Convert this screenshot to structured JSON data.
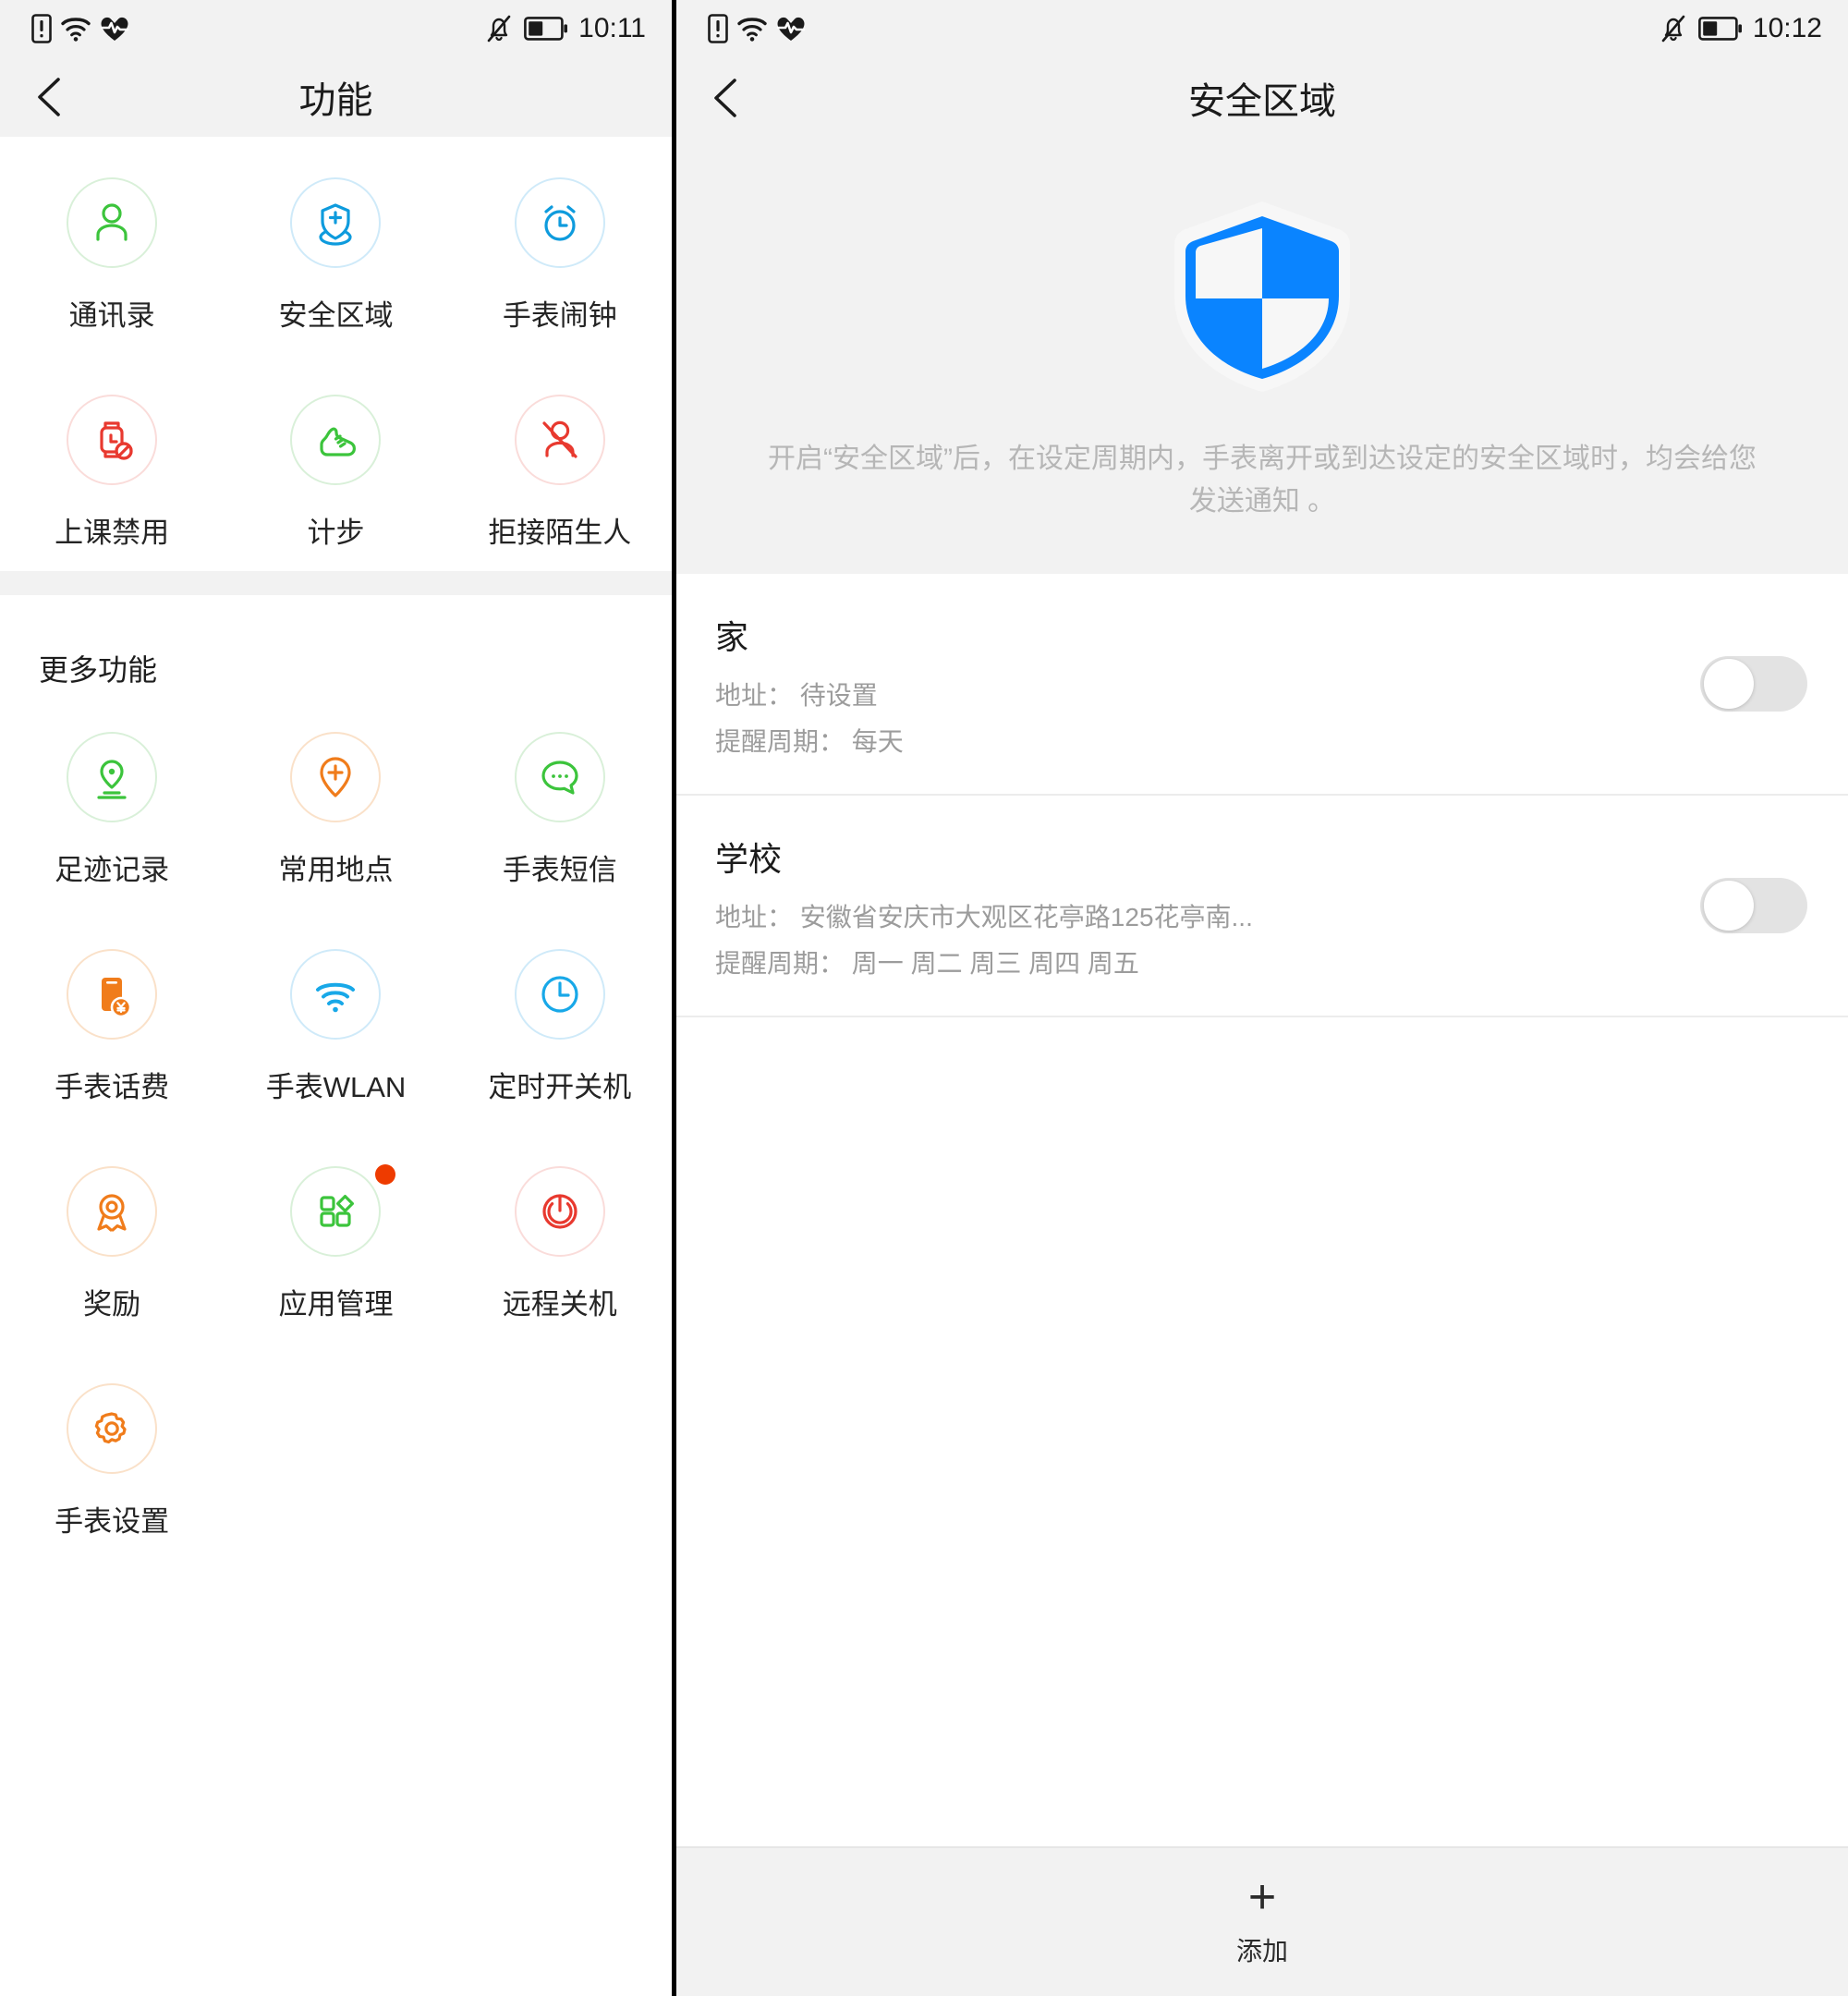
{
  "left_screen": {
    "status": {
      "time": "10:11",
      "icons": [
        "sim-alert-icon",
        "wifi-icon",
        "heart-rate-icon",
        "bell-muted-icon",
        "battery-icon"
      ]
    },
    "title": "功能",
    "back_icon": "back-arrow-icon",
    "top_features": [
      {
        "label": "通讯录",
        "icon": "contacts-icon",
        "color": "#3cc43c",
        "ring": "#d9f0d9"
      },
      {
        "label": "安全区域",
        "icon": "safe-zone-icon",
        "color": "#0e9bdd",
        "ring": "#cfeaf9"
      },
      {
        "label": "手表闹钟",
        "icon": "alarm-clock-icon",
        "color": "#0e9bdd",
        "ring": "#cfeaf9"
      },
      {
        "label": "上课禁用",
        "icon": "class-disable-icon",
        "color": "#e8392f",
        "ring": "#fadcda"
      },
      {
        "label": "计步",
        "icon": "pedometer-icon",
        "color": "#3cc43c",
        "ring": "#d9f0d9"
      },
      {
        "label": "拒接陌生人",
        "icon": "reject-stranger-icon",
        "color": "#e8392f",
        "ring": "#fadcda"
      }
    ],
    "more_section_title": "更多功能",
    "more_features": [
      {
        "label": "足迹记录",
        "icon": "footprint-track-icon",
        "color": "#3cc43c",
        "ring": "#d9f0d9",
        "badge": false
      },
      {
        "label": "常用地点",
        "icon": "favorite-place-icon",
        "color": "#f07c1b",
        "ring": "#fae1c9",
        "badge": false
      },
      {
        "label": "手表短信",
        "icon": "watch-sms-icon",
        "color": "#3cc43c",
        "ring": "#d9f0d9",
        "badge": false
      },
      {
        "label": "手表话费",
        "icon": "watch-balance-icon",
        "color": "#f07c1b",
        "ring": "#fae1c9",
        "badge": false
      },
      {
        "label": "手表WLAN",
        "icon": "wifi-icon",
        "color": "#18a8e8",
        "ring": "#cfeaf9",
        "badge": false
      },
      {
        "label": "定时开关机",
        "icon": "scheduled-power-icon",
        "color": "#18a8e8",
        "ring": "#cfeaf9",
        "badge": false
      },
      {
        "label": "奖励",
        "icon": "reward-medal-icon",
        "color": "#f07c1b",
        "ring": "#fae1c9",
        "badge": false
      },
      {
        "label": "应用管理",
        "icon": "app-manage-icon",
        "color": "#3cc43c",
        "ring": "#d9f0d9",
        "badge": true
      },
      {
        "label": "远程关机",
        "icon": "remote-power-off-icon",
        "color": "#e8392f",
        "ring": "#fadcda",
        "badge": false
      },
      {
        "label": "手表设置",
        "icon": "watch-settings-icon",
        "color": "#f07c1b",
        "ring": "#fae1c9",
        "badge": false
      }
    ]
  },
  "right_screen": {
    "status": {
      "time": "10:12",
      "icons": [
        "sim-alert-icon",
        "wifi-icon",
        "heart-rate-icon",
        "bell-muted-icon",
        "battery-icon"
      ]
    },
    "title": "安全区域",
    "back_icon": "back-arrow-icon",
    "hero": {
      "icon": "shield-icon",
      "shield_color": "#0a84ff",
      "description": "开启“安全区域”后，在设定周期内，手表离开或到达设定的安全区域时，均会给您发送通知 。"
    },
    "zones": [
      {
        "name": "家",
        "address_label": "地址：",
        "address_value": "待设置",
        "period_label": "提醒周期：",
        "period_value": "每天",
        "enabled": false
      },
      {
        "name": "学校",
        "address_label": "地址：",
        "address_value": "安徽省安庆市大观区花亭路125花亭南...",
        "period_label": "提醒周期：",
        "period_value": "周一 周二 周三 周四 周五",
        "enabled": false
      }
    ],
    "add_button": {
      "icon": "plus-icon",
      "label": "添加"
    }
  }
}
